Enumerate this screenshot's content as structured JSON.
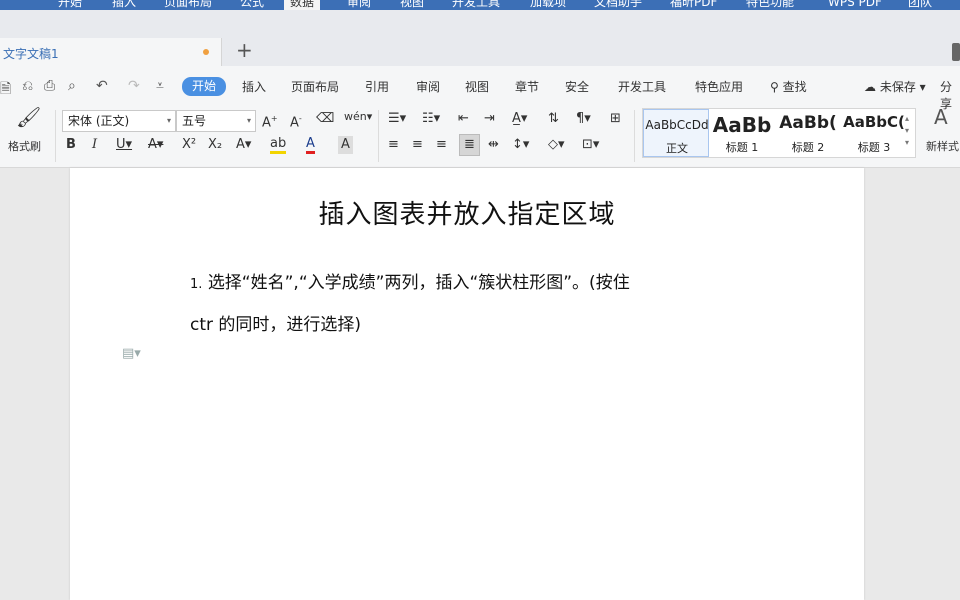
{
  "top_menu": {
    "tabs": [
      "开始",
      "插入",
      "页面布局",
      "公式",
      "数据",
      "审阅",
      "视图",
      "开发工具",
      "加载项",
      "文档助手",
      "福昕PDF",
      "特色功能",
      "WPS PDF",
      "团队"
    ],
    "active": "数据"
  },
  "document_tab": {
    "title": "文字文稿1",
    "new_tab": "+"
  },
  "ribbon": {
    "tabs": [
      "开始",
      "插入",
      "页面布局",
      "引用",
      "审阅",
      "视图",
      "章节",
      "安全",
      "开发工具",
      "特色应用"
    ],
    "active_tab": "开始",
    "search": "查找",
    "save_status": "未保存",
    "share": "分享",
    "format_painter": "格式刷",
    "font_name": "宋体 (正文)",
    "font_size": "五号",
    "new_style": "新样式",
    "styles": [
      {
        "sample": "AaBbCcDd",
        "name": "正文"
      },
      {
        "sample": "AaBb",
        "name": "标题 1"
      },
      {
        "sample": "AaBb(",
        "name": "标题 2"
      },
      {
        "sample": "AaBbC(",
        "name": "标题 3"
      }
    ],
    "colors": {
      "accent": "#4a90e2",
      "highlight": "#f2d400",
      "font_color": "#e02020"
    }
  },
  "document": {
    "title": "插入图表并放入指定区域",
    "para1_num": "1.",
    "para1": "选择“姓名”,“入学成绩”两列，插入“簇状柱形图”。(按住",
    "para2": "ctr 的同时，进行选择)"
  }
}
